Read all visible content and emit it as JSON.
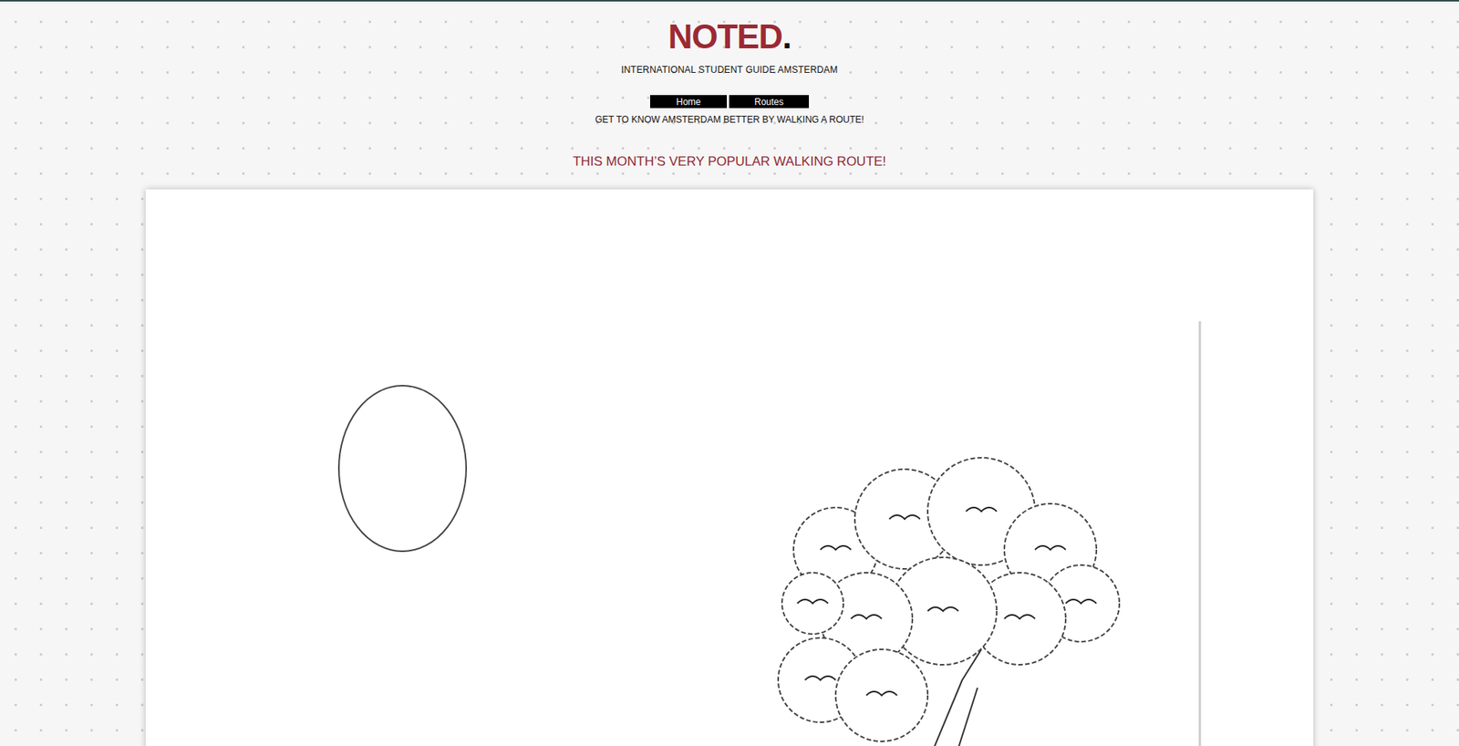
{
  "header": {
    "logo": {
      "text": "NOTED",
      "dot": "."
    },
    "subtitle": "INTERNATIONAL STUDENT GUIDE AMSTERDAM"
  },
  "nav": [
    {
      "label": "Home"
    },
    {
      "label": "Routes"
    }
  ],
  "tagline": "GET TO KNOW AMSTERDAM BETTER BY WALKING A ROUTE!",
  "feature": {
    "title": "THIS MONTH’S VERY POPULAR WALKING ROUTE!"
  }
}
